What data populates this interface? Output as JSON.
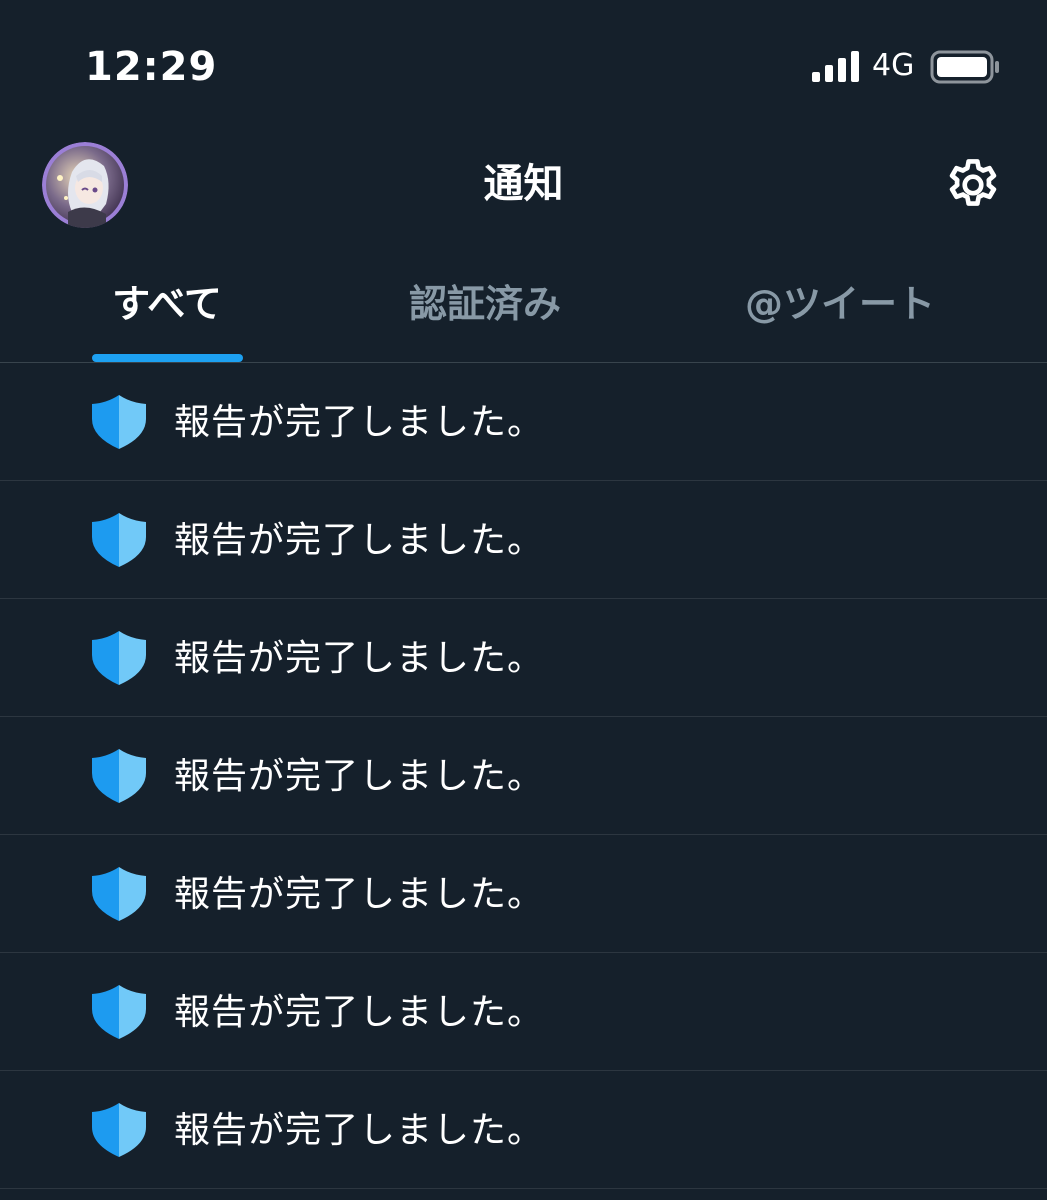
{
  "status_bar": {
    "time": "12:29",
    "network": "4G"
  },
  "header": {
    "title": "通知"
  },
  "tabs": [
    {
      "label": "すべて",
      "active": true
    },
    {
      "label": "認証済み",
      "active": false
    },
    {
      "label": "@ツイート",
      "active": false
    }
  ],
  "notifications": [
    {
      "icon": "shield-icon",
      "text": "報告が完了しました。"
    },
    {
      "icon": "shield-icon",
      "text": "報告が完了しました。"
    },
    {
      "icon": "shield-icon",
      "text": "報告が完了しました。"
    },
    {
      "icon": "shield-icon",
      "text": "報告が完了しました。"
    },
    {
      "icon": "shield-icon",
      "text": "報告が完了しました。"
    },
    {
      "icon": "shield-icon",
      "text": "報告が完了しました。"
    },
    {
      "icon": "shield-icon",
      "text": "報告が完了しました。"
    }
  ],
  "colors": {
    "background": "#15202b",
    "accent": "#1da1f2",
    "tab_inactive": "#8899a6",
    "divider": "#38444d"
  }
}
